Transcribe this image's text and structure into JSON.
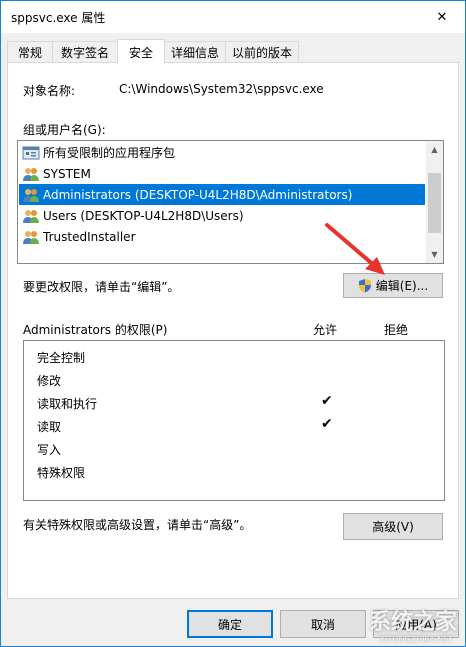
{
  "window": {
    "title": "sppsvc.exe 属性",
    "close_glyph": "✕"
  },
  "tabs": [
    {
      "label": "常规"
    },
    {
      "label": "数字签名"
    },
    {
      "label": "安全"
    },
    {
      "label": "详细信息"
    },
    {
      "label": "以前的版本"
    }
  ],
  "security": {
    "object_name_label": "对象名称:",
    "object_name_value": "C:\\Windows\\System32\\sppsvc.exe",
    "group_label": "组或用户名(G):",
    "principals": [
      {
        "name": "所有受限制的应用程序包",
        "icon": "app-package-icon"
      },
      {
        "name": "SYSTEM",
        "icon": "users-icon"
      },
      {
        "name": "Administrators (DESKTOP-U4L2H8D\\Administrators)",
        "icon": "users-icon",
        "selected": true
      },
      {
        "name": "Users (DESKTOP-U4L2H8D\\Users)",
        "icon": "users-icon"
      },
      {
        "name": "TrustedInstaller",
        "icon": "users-icon"
      }
    ],
    "change_hint": "要更改权限，请单击“编辑”。",
    "edit_button": "编辑(E)...",
    "perm_header": "Administrators 的权限(P)",
    "allow_header": "允许",
    "deny_header": "拒绝",
    "permissions": [
      {
        "name": "完全控制",
        "allow": false,
        "deny": false
      },
      {
        "name": "修改",
        "allow": false,
        "deny": false
      },
      {
        "name": "读取和执行",
        "allow": true,
        "deny": false
      },
      {
        "name": "读取",
        "allow": true,
        "deny": false
      },
      {
        "name": "写入",
        "allow": false,
        "deny": false
      },
      {
        "name": "特殊权限",
        "allow": false,
        "deny": false
      }
    ],
    "check_glyph": "✔",
    "advanced_hint": "有关特殊权限或高级设置，请单击“高级”。",
    "advanced_button": "高级(V)"
  },
  "footer": {
    "ok_button": "确定",
    "cancel_button": "取消",
    "apply_button": "应用(A)"
  },
  "watermark": {
    "text": "系统之家",
    "url": "XITONGZHIJIA.NET"
  },
  "colors": {
    "accent": "#0078d7",
    "arrow": "#e8332d"
  }
}
